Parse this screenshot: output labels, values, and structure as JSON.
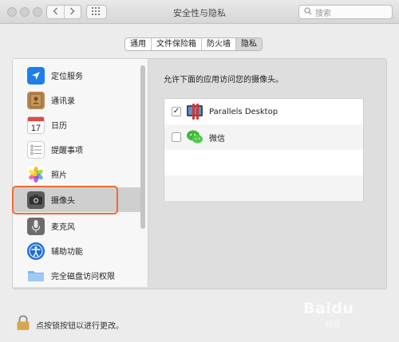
{
  "window": {
    "title": "安全性与隐私",
    "search_placeholder": "搜索"
  },
  "tabs": [
    {
      "label": "通用",
      "active": false
    },
    {
      "label": "文件保险箱",
      "active": false
    },
    {
      "label": "防火墙",
      "active": false
    },
    {
      "label": "隐私",
      "active": true
    }
  ],
  "sidebar": {
    "items": [
      {
        "label": "定位服务",
        "icon": "location-arrow-icon"
      },
      {
        "label": "通讯录",
        "icon": "contacts-book-icon"
      },
      {
        "label": "日历",
        "icon": "calendar-icon",
        "calendar_day": "17"
      },
      {
        "label": "提醒事项",
        "icon": "reminders-icon"
      },
      {
        "label": "照片",
        "icon": "photos-flower-icon"
      },
      {
        "label": "摄像头",
        "icon": "camera-icon",
        "selected": true
      },
      {
        "label": "麦克风",
        "icon": "microphone-icon"
      },
      {
        "label": "辅助功能",
        "icon": "accessibility-icon"
      },
      {
        "label": "完全磁盘访问权限",
        "icon": "folder-icon"
      }
    ]
  },
  "main": {
    "description": "允许下面的应用访问您的摄像头。",
    "apps": [
      {
        "name": "Parallels Desktop",
        "checked": true,
        "check_mark": "✓",
        "icon": "parallels-icon"
      },
      {
        "name": "微信",
        "checked": false,
        "check_mark": "",
        "icon": "wechat-icon"
      }
    ]
  },
  "footer": {
    "lock_text": "点按锁按钮以进行更改。"
  },
  "watermark": {
    "brand": "Baidu",
    "sub": "经验"
  },
  "colors": {
    "highlight": "#ee6a34",
    "location": "#1e7fe8",
    "accessibility": "#1e6fd6",
    "wechat": "#3ebb3a"
  }
}
